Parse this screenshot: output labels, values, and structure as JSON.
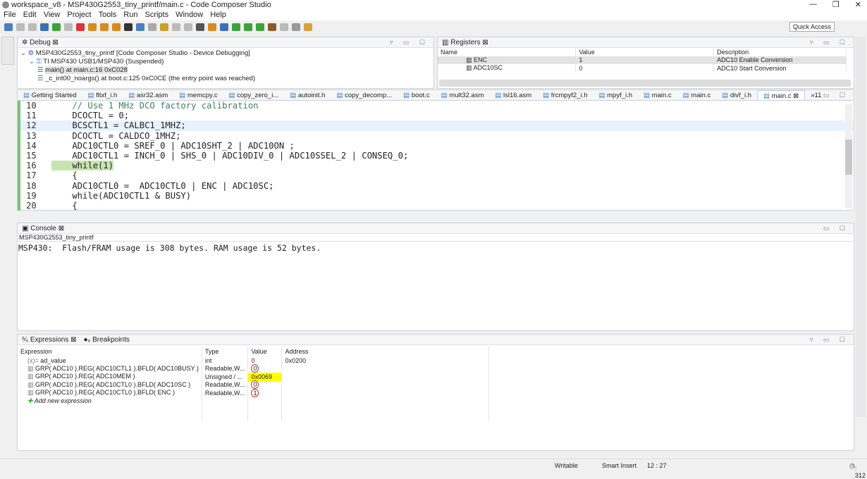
{
  "window": {
    "title": "workspace_v8 - MSP430G2553_tiny_printf/main.c - Code Composer Studio",
    "controls": [
      "—",
      "❐",
      "✕"
    ]
  },
  "menu": [
    "File",
    "Edit",
    "View",
    "Project",
    "Tools",
    "Run",
    "Scripts",
    "Window",
    "Help"
  ],
  "toolbar": {
    "quick_access": "Quick Access"
  },
  "debug": {
    "title": "Debug",
    "items": [
      {
        "label": "MSP430G2553_tiny_printf [Code Composer Studio - Device Debugging]",
        "level": 0
      },
      {
        "label": "TI MSP430 USB1/MSP430 (Suspended)",
        "level": 1
      },
      {
        "label": "main() at main.c:16 0xC028",
        "level": 2,
        "selected": true
      },
      {
        "label": "_c_int00_noargs() at boot.c:125 0xC0CE  (the entry point was reached)",
        "level": 2
      }
    ]
  },
  "registers": {
    "title": "Registers",
    "columns": [
      "Name",
      "Value",
      "Description"
    ],
    "rows": [
      {
        "name": "ENC",
        "value": "1",
        "description": "ADC10 Enable Conversion",
        "selected": true
      },
      {
        "name": "ADC10SC",
        "value": "0",
        "description": "ADC10 Start Conversion"
      }
    ]
  },
  "editor": {
    "tabs": [
      "Getting Started",
      "fltxf_i.h",
      "asr32.asm",
      "memcpy.c",
      "copy_zero_i...",
      "autoinit.h",
      "copy_decomp...",
      "boot.c",
      "mult32.asm",
      "lsl16.asm",
      "frcmpyf2_i.h",
      "mpyf_i.h",
      "main.c",
      "main.c",
      "divf_i.h",
      "main.c"
    ],
    "active_tab": 15,
    "overflow": "»11",
    "lines": [
      {
        "n": "10",
        "text": "    // Use 1 MHz DCO factory calibration",
        "type": "comment"
      },
      {
        "n": "11",
        "text": "    DCOCTL = 0;"
      },
      {
        "n": "12",
        "text": "    BCSCTL1 = CALBC1_1MHZ;",
        "current": true
      },
      {
        "n": "13",
        "text": "    DCOCTL = CALDCO_1MHZ;"
      },
      {
        "n": "14",
        "text": "    ADC10CTL0 = SREF_0 | ADC10SHT_2 | ADC10ON ;"
      },
      {
        "n": "15",
        "text": "    ADC10CTL1 = INCH_0 | SHS_0 | ADC10DIV_0 | ADC10SSEL_2 | CONSEQ_0;"
      },
      {
        "n": "16",
        "text": "    while(1)",
        "type": "keyword",
        "pc": true
      },
      {
        "n": "17",
        "text": "    {"
      },
      {
        "n": "18",
        "text": "    ADC10CTL0 =  ADC10CTL0 | ENC | ADC10SC;"
      },
      {
        "n": "19",
        "text": "    while(ADC10CTL1 & BUSY)",
        "type": "keyword"
      },
      {
        "n": "20",
        "text": "    {"
      }
    ]
  },
  "console": {
    "title": "Console",
    "subtitle": "MSP430G2553_tiny_printf",
    "output": "MSP430:  Flash/FRAM usage is 308 bytes. RAM usage is 52 bytes."
  },
  "expressions": {
    "tabs": [
      "Expressions",
      "Breakpoints"
    ],
    "columns": [
      "Expression",
      "Type",
      "Value",
      "Address"
    ],
    "rows": [
      {
        "expr": "ad_value",
        "type": "int",
        "value": "0",
        "address": "0x0200",
        "icon": "(x)="
      },
      {
        "expr": "GRP( ADC10 ).REG( ADC10CTL1 ).BFLD( ADC10BUSY )",
        "type": "Readable,W...",
        "value": "0",
        "address": "",
        "circled": true
      },
      {
        "expr": "GRP( ADC10 ).REG( ADC10MEM )",
        "type": "Unsigned / ...",
        "value": "0x0069",
        "address": "",
        "highlight": "#ffff00"
      },
      {
        "expr": "GRP( ADC10 ).REG( ADC10CTL0 ).BFLD( ADC10SC )",
        "type": "Readable,W...",
        "value": "0",
        "address": "",
        "circled": true
      },
      {
        "expr": "GRP( ADC10 ).REG( ADC10CTL0 ).BFLD( ENC )",
        "type": "Readable,W...",
        "value": "1",
        "address": "",
        "circled": true
      }
    ],
    "add": "Add new expression"
  },
  "status": {
    "writable": "Writable",
    "insert": "Smart Insert",
    "position": "12 : 27",
    "heap": ": 312"
  }
}
